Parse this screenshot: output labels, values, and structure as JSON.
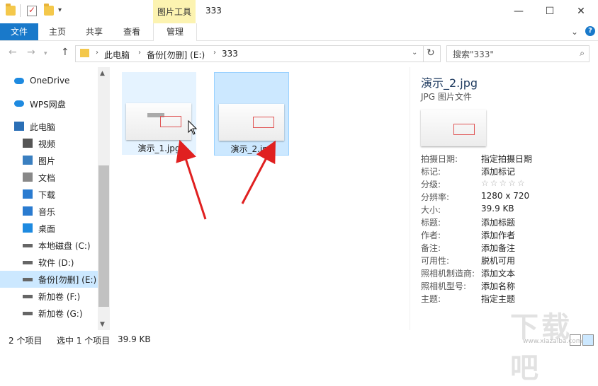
{
  "titlebar": {
    "contextual_tab": "图片工具",
    "window_title": "333",
    "minimize": "—",
    "maximize": "☐",
    "close": "✕"
  },
  "ribbon": {
    "tabs": [
      "文件",
      "主页",
      "共享",
      "查看",
      "管理"
    ]
  },
  "address": {
    "crumbs": [
      "此电脑",
      "备份[勿删] (E:)",
      "333"
    ],
    "search_placeholder": "搜索\"333\""
  },
  "nav": {
    "items": [
      {
        "label": "OneDrive",
        "icon": "cloud-icon"
      },
      {
        "label": "WPS网盘",
        "icon": "cloud-icon"
      },
      {
        "label": "此电脑",
        "icon": "computer-icon"
      },
      {
        "label": "视频",
        "icon": "video-icon"
      },
      {
        "label": "图片",
        "icon": "picture-icon"
      },
      {
        "label": "文档",
        "icon": "document-icon"
      },
      {
        "label": "下载",
        "icon": "download-icon"
      },
      {
        "label": "音乐",
        "icon": "music-icon"
      },
      {
        "label": "桌面",
        "icon": "desktop-icon"
      },
      {
        "label": "本地磁盘 (C:)",
        "icon": "drive-icon"
      },
      {
        "label": "软件 (D:)",
        "icon": "drive-icon"
      },
      {
        "label": "备份[勿删] (E:)",
        "icon": "drive-icon"
      },
      {
        "label": "新加卷 (F:)",
        "icon": "drive-icon"
      },
      {
        "label": "新加卷 (G:)",
        "icon": "drive-icon"
      }
    ]
  },
  "files": [
    {
      "name": "演示_1.jpg",
      "state": "hover"
    },
    {
      "name": "演示_2.jpg",
      "state": "selected"
    }
  ],
  "preview": {
    "title": "演示_2.jpg",
    "type": "JPG 图片文件",
    "properties": [
      {
        "key": "拍摄日期:",
        "value": "指定拍摄日期"
      },
      {
        "key": "标记:",
        "value": "添加标记"
      },
      {
        "key": "分级:",
        "value": "☆☆☆☆☆"
      },
      {
        "key": "分辨率:",
        "value": "1280 x 720"
      },
      {
        "key": "大小:",
        "value": "39.9 KB"
      },
      {
        "key": "标题:",
        "value": "添加标题"
      },
      {
        "key": "作者:",
        "value": "添加作者"
      },
      {
        "key": "备注:",
        "value": "添加备注"
      },
      {
        "key": "可用性:",
        "value": "脱机可用"
      },
      {
        "key": "照相机制造商:",
        "value": "添加文本"
      },
      {
        "key": "照相机型号:",
        "value": "添加名称"
      },
      {
        "key": "主题:",
        "value": "指定主题"
      }
    ]
  },
  "status": {
    "count": "2 个项目",
    "selection": "选中 1 个项目",
    "size": "39.9 KB"
  },
  "watermark": {
    "text": "下载吧",
    "url": "www.xiazaiba.com"
  },
  "colors": {
    "accent": "#1979ca",
    "selected": "#cce8ff",
    "hover": "#e5f3ff",
    "contextual": "#fcf3b1",
    "annotation_arrow": "#e02020"
  }
}
